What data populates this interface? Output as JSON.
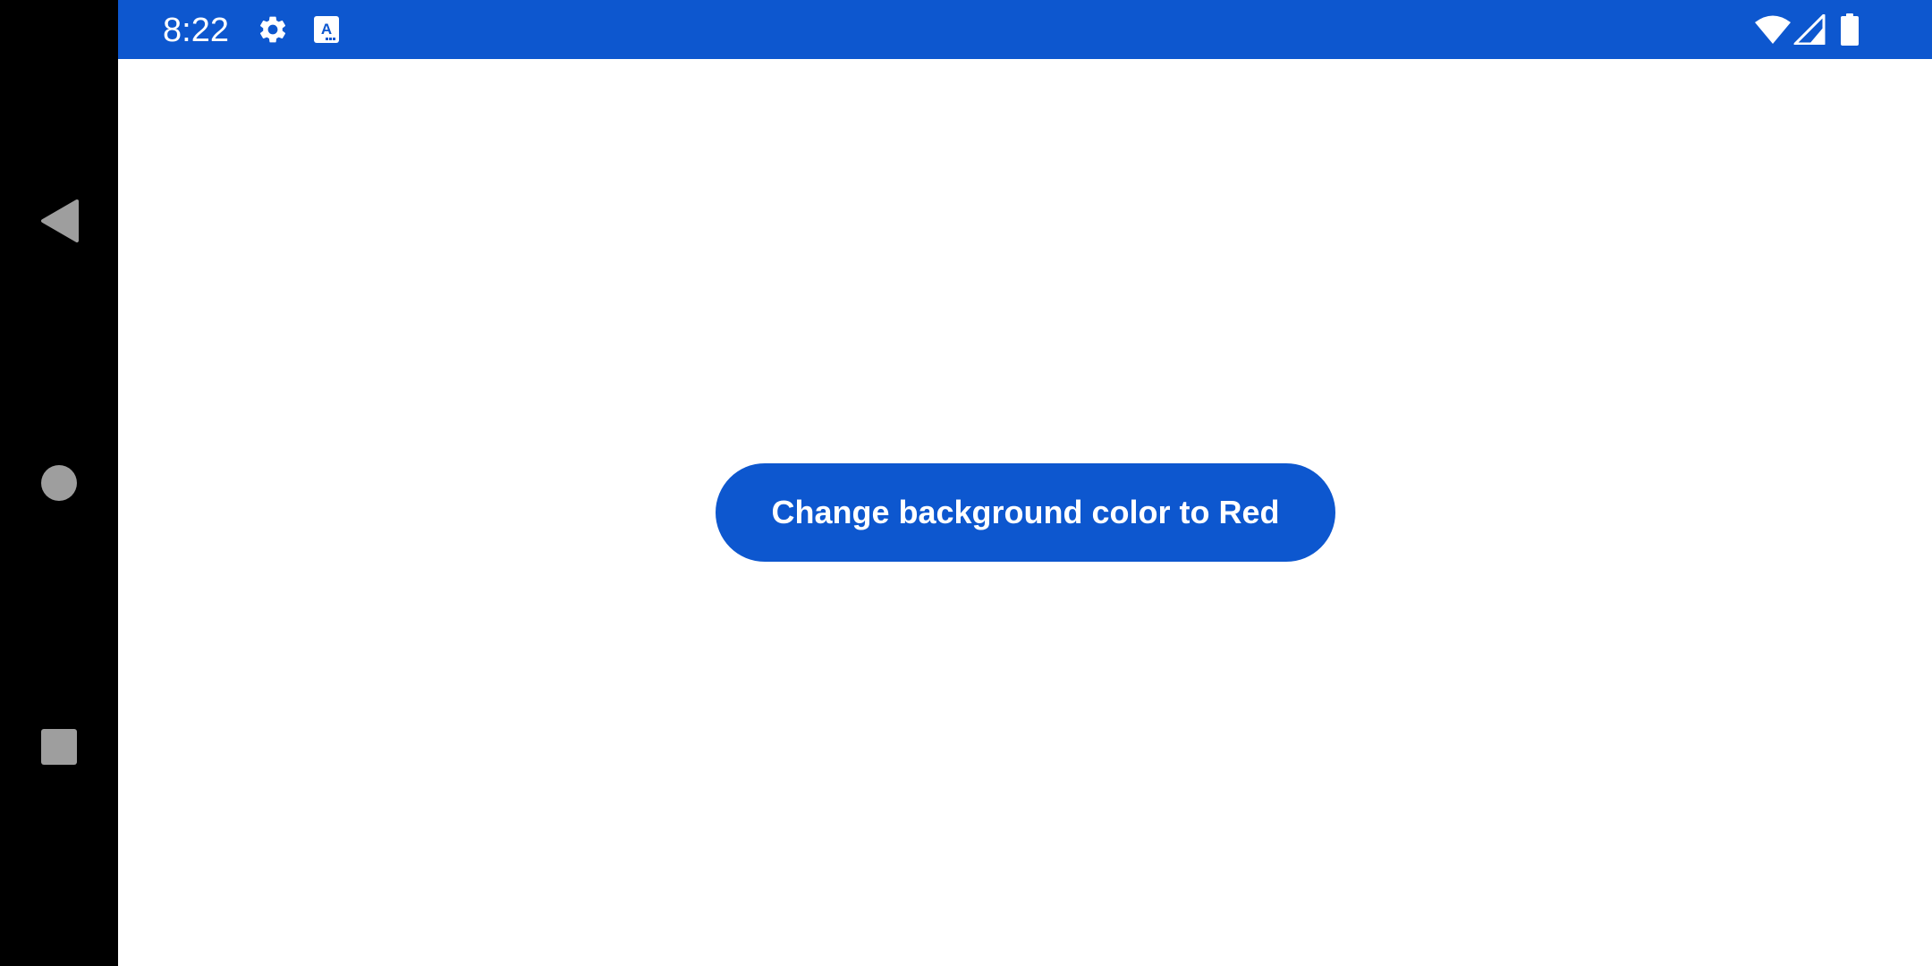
{
  "colors": {
    "accent": "#0d57cf",
    "nav_background": "#000000",
    "nav_icon": "#9e9e9e",
    "content_background": "#ffffff",
    "on_accent": "#ffffff"
  },
  "status_bar": {
    "time": "8:22",
    "icons": [
      "gear-icon",
      "a-icon",
      "wifi-icon",
      "signal-icon",
      "battery-icon"
    ]
  },
  "navigation_bar": {
    "buttons": [
      "back-icon",
      "home-icon",
      "recents-icon"
    ]
  },
  "main": {
    "button_label": "Change background color to Red"
  }
}
